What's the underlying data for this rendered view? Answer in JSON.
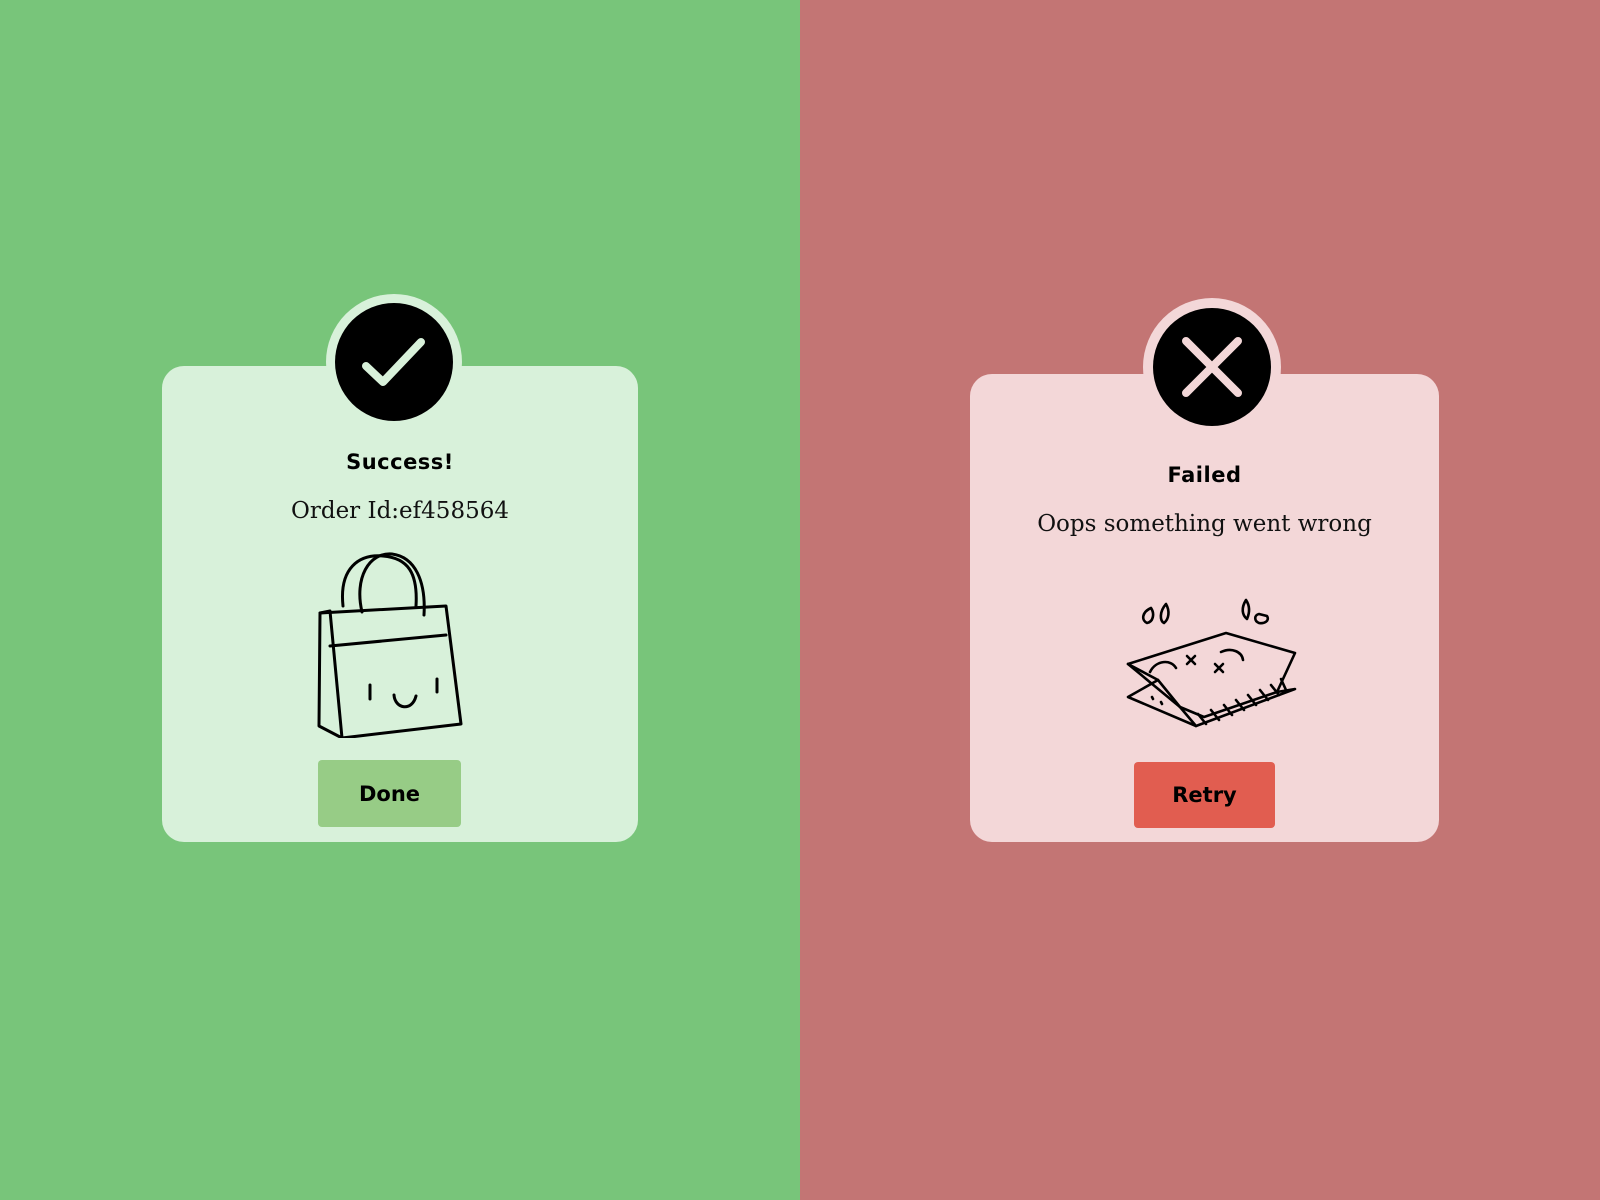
{
  "success": {
    "background_color": "#78c57a",
    "card_color": "#d8f1da",
    "badge_ring_color": "#d8f1da",
    "icon": "checkmark-icon",
    "title": "Success!",
    "message": "Order Id:ef458564",
    "illustration": "smiling-shopping-bag-illustration",
    "button_label": "Done",
    "button_color": "#97cc86"
  },
  "failed": {
    "background_color": "#c37574",
    "card_color": "#f3d7d8",
    "badge_ring_color": "#f3d7d8",
    "icon": "close-icon",
    "title": "Failed",
    "message": "Oops something went wrong",
    "illustration": "crumpled-shopping-bag-illustration",
    "button_label": "Retry",
    "button_color": "#e15d50"
  }
}
